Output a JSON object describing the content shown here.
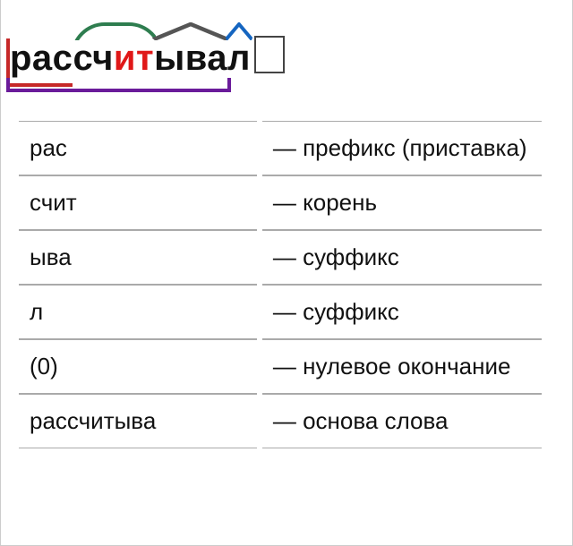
{
  "word": {
    "prefix": "рас",
    "root_part1": "сч",
    "root_highlight": "ит",
    "suffix1": "ыва",
    "suffix2": "л"
  },
  "rows": [
    {
      "part": "рас",
      "desc": "— префикс (приставка)"
    },
    {
      "part": "счит",
      "desc": "— корень"
    },
    {
      "part": "ыва",
      "desc": "— суффикс"
    },
    {
      "part": "л",
      "desc": "— суффикс"
    },
    {
      "part": "(0)",
      "desc": "— нулевое окончание"
    },
    {
      "part": "рассчитыва",
      "desc": "— основа слова"
    }
  ]
}
